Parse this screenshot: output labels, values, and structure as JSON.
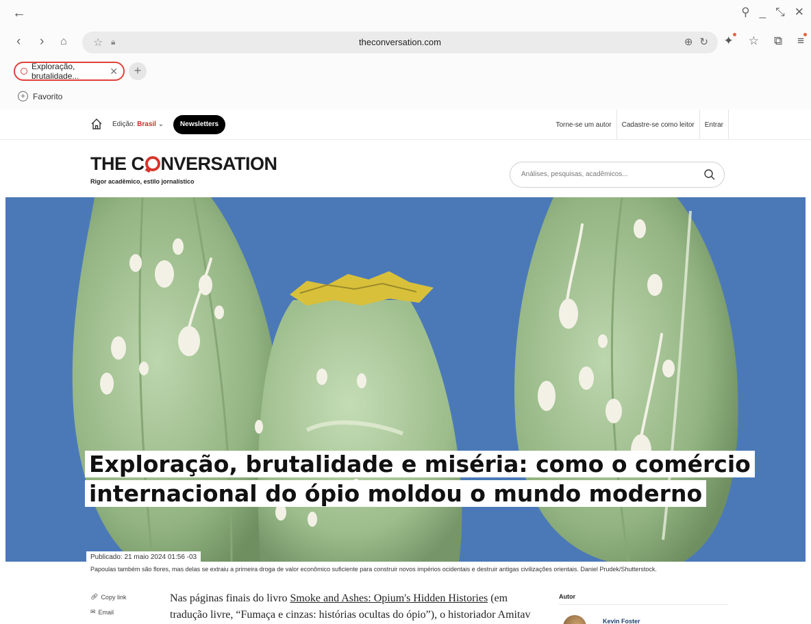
{
  "browser": {
    "url": "theconversation.com",
    "tab_title": "Exploração, brutalidade...",
    "bookmark_label": "Favorito"
  },
  "site_nav": {
    "edition_label": "Edição:",
    "edition_value": "Brasil",
    "newsletters_label": "Newsletters",
    "links": [
      "Torne-se um autor",
      "Cadastre-se como leitor",
      "Entrar"
    ]
  },
  "brand": {
    "logo_pre": "THE C",
    "logo_post": "NVERSATION",
    "tagline": "Rigor acadêmico, estilo jornalístico",
    "search_placeholder": "Análises, pesquisas, acadêmicos..."
  },
  "article": {
    "headline": "Exploração, brutalidade e miséria: como o comércio internacional do ópio moldou o mundo moderno",
    "published": "Publicado: 21 maio 2024 01:56 -03",
    "caption": "Papoulas também são flores, mas delas se extraiu a primeira droga de valor econômico suficiente para construir novos impérios ocidentais e destruir antigas civilizações orientais. Daniel Prudek/Shutterstock.",
    "body_pre": "Nas páginas finais do livro ",
    "body_link": "Smoke and Ashes: Opium's Hidden Histories",
    "body_post": " (em tradução livre, “Fumaça e cinzas: histórias ocultas do ópio”), o historiador Amitav"
  },
  "share": {
    "copy_link": "Copy link",
    "email": "Email"
  },
  "sidebar": {
    "author_heading": "Autor",
    "author_name": "Kevin Foster"
  },
  "colors": {
    "brand_red": "#d8352a",
    "sky": "#4b79b8",
    "pod_green": "#a9c79a"
  }
}
